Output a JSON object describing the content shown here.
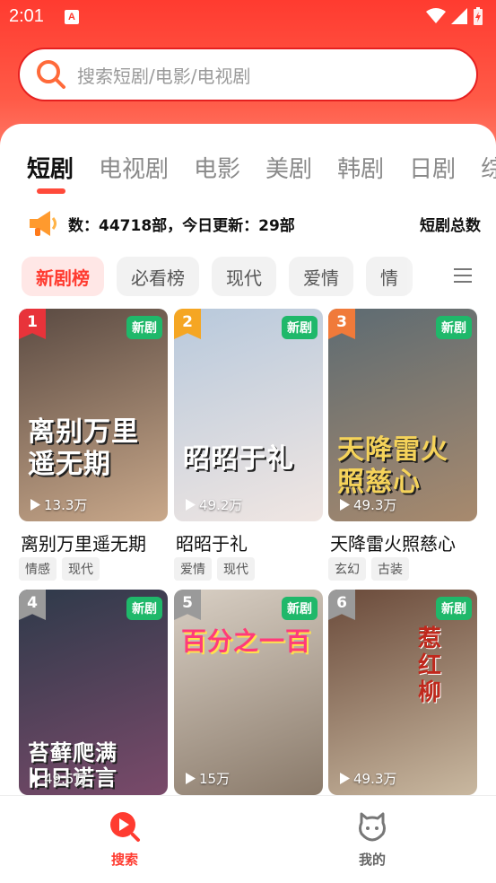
{
  "status": {
    "time": "2:01",
    "app_icon_letter": "A"
  },
  "search": {
    "placeholder": "搜索短剧/电影/电视剧"
  },
  "tabs": [
    {
      "label": "短剧",
      "active": true
    },
    {
      "label": "电视剧",
      "active": false
    },
    {
      "label": "电影",
      "active": false
    },
    {
      "label": "美剧",
      "active": false
    },
    {
      "label": "韩剧",
      "active": false
    },
    {
      "label": "日剧",
      "active": false
    },
    {
      "label": "综",
      "active": false
    }
  ],
  "notice": {
    "text": "数：44718部，今日更新：29部",
    "text_repeat": "短剧总数"
  },
  "chips": [
    {
      "label": "新剧榜",
      "active": true
    },
    {
      "label": "必看榜",
      "active": false
    },
    {
      "label": "现代",
      "active": false
    },
    {
      "label": "爱情",
      "active": false
    },
    {
      "label": "情",
      "active": false
    }
  ],
  "items": [
    {
      "rank": "1",
      "badge": "新剧",
      "views": "13.3万",
      "title": "离别万里遥无期",
      "poster_text": "离别万里\n遥无期",
      "tags": [
        "情感",
        "现代"
      ],
      "rank_color": "#e8333a",
      "poster_colors": [
        "#5a4a42",
        "#c9a88a"
      ]
    },
    {
      "rank": "2",
      "badge": "新剧",
      "views": "49.2万",
      "title": "昭昭于礼",
      "poster_text": "昭昭于礼",
      "tags": [
        "爱情",
        "现代"
      ],
      "rank_color": "#f5a623",
      "poster_colors": [
        "#b8c9dc",
        "#f0e6e2"
      ]
    },
    {
      "rank": "3",
      "badge": "新剧",
      "views": "49.3万",
      "title": "天降雷火照慈心",
      "poster_text": "天降雷火\n照慈心",
      "tags": [
        "玄幻",
        "古装"
      ],
      "rank_color": "#f07a3a",
      "poster_colors": [
        "#5d6b72",
        "#a88a6e"
      ]
    },
    {
      "rank": "4",
      "badge": "新剧",
      "views": "49.5万",
      "title": "",
      "poster_text": "苔藓爬满\n旧日诺言",
      "tags": [],
      "rank_color": "#9a9a9a",
      "poster_colors": [
        "#2e3a4a",
        "#7a4a6a"
      ]
    },
    {
      "rank": "5",
      "badge": "新剧",
      "views": "15万",
      "title": "",
      "poster_text": "百分之一百",
      "tags": [],
      "rank_color": "#9a9a9a",
      "poster_colors": [
        "#d8cfc4",
        "#8a7a6a"
      ]
    },
    {
      "rank": "6",
      "badge": "新剧",
      "views": "49.3万",
      "title": "",
      "poster_text": "惹红柳",
      "tags": [],
      "rank_color": "#9a9a9a",
      "poster_colors": [
        "#6a4a3a",
        "#c9b8a0"
      ]
    }
  ],
  "nav": [
    {
      "label": "搜索",
      "icon": "search-play-icon",
      "active": true
    },
    {
      "label": "我的",
      "icon": "profile-icon",
      "active": false
    }
  ],
  "colors": {
    "accent": "#ff3b30",
    "badge_green": "#1fb86a",
    "nav_inactive": "#666666"
  }
}
